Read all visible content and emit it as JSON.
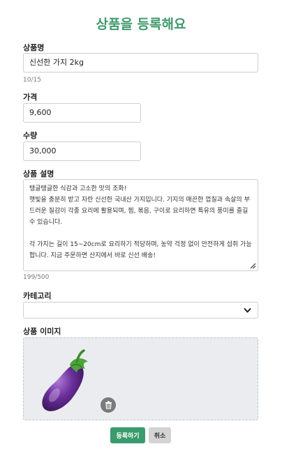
{
  "form": {
    "title": "상품을 등록해요",
    "name_label": "상품명",
    "name_value": "신선한 가지 2kg",
    "name_counter": "10/15",
    "price_label": "가격",
    "price_value": "9,600",
    "quantity_label": "수량",
    "quantity_value": "30,000",
    "description_label": "상품 설명",
    "description_lines": [
      "탱글탱글한 식감과 고소한 맛의 조화!",
      "햇빛을 충분히 받고 자란 신선한 국내산 가지입니다. 기지의 매끈한 껍질과 속살의 부드러운 질감이 각종 요리에 활용되며, 찜, 볶음, 구이로 요리하면 특유의 풍미를 즐길 수 있습니다.",
      "",
      "각 가지는 길이 15~20cm로 요리하기 적당하며, 농약 걱정 없이 안전하게 섭취 가능합니다. 지금 주문하면 산지에서 바로 신선 배송!"
    ],
    "description_counter": "199/500",
    "category_label": "카테고리",
    "category_value": "",
    "image_label": "상품 이미지",
    "submit_label": "등록하기",
    "cancel_label": "취소"
  },
  "colors": {
    "accent": "#3f9a6b",
    "submit_bg": "#3a9b6c",
    "cancel_bg": "#d3d3d3",
    "upload_bg": "#eaecef"
  },
  "icons": {
    "product_image": "eggplant-image",
    "delete": "trash-icon",
    "dropdown": "chevron-down-icon",
    "resize": "resize-grip-icon"
  }
}
